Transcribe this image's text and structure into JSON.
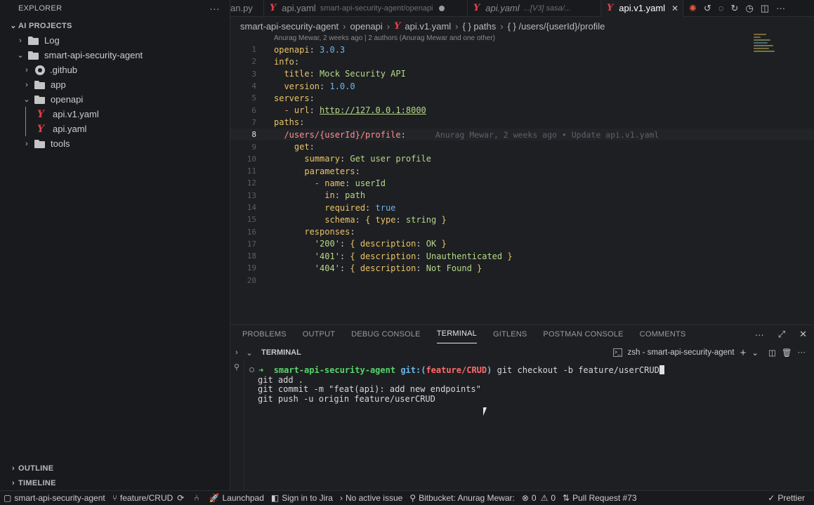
{
  "sidebar": {
    "title": "EXPLORER",
    "section": "AI PROJECTS",
    "items": [
      {
        "label": "Log",
        "type": "folder"
      },
      {
        "label": "smart-api-security-agent",
        "type": "folder-open"
      },
      {
        "label": ".github",
        "type": "github"
      },
      {
        "label": "app",
        "type": "folder"
      },
      {
        "label": "openapi",
        "type": "folder-open"
      },
      {
        "label": "api.v1.yaml",
        "type": "yaml"
      },
      {
        "label": "api.yaml",
        "type": "yaml"
      },
      {
        "label": "tools",
        "type": "folder"
      }
    ],
    "outline": "OUTLINE",
    "timeline": "TIMELINE"
  },
  "tabs": [
    {
      "label": "an.py"
    },
    {
      "label": "api.yaml",
      "desc": "smart-api-security-agent/openapi"
    },
    {
      "label": "api.yaml",
      "desc": "...[V3] sasa/..."
    },
    {
      "label": "api.v1.yaml"
    }
  ],
  "breadcrumb": [
    "smart-api-security-agent",
    "openapi",
    "api.v1.yaml",
    "{ } paths",
    "{ } /users/{userId}/profile"
  ],
  "blame_header": "Anurag Mewar, 2 weeks ago | 2 authors (Anurag Mewar and one other)",
  "editor": {
    "current_line": "8",
    "line_numbers": [
      "1",
      "2",
      "3",
      "4",
      "5",
      "6",
      "7",
      "8",
      "9",
      "10",
      "11",
      "12",
      "13",
      "14",
      "15",
      "16",
      "17",
      "18",
      "19",
      "20"
    ],
    "inline_blame": "Anurag Mewar, 2 weeks ago • Update api.v1.yaml",
    "l1": {
      "k": "openapi",
      "v": "3.0.3"
    },
    "l2": {
      "k": "info"
    },
    "l3": {
      "k": "title",
      "v": "Mock Security API"
    },
    "l4": {
      "k": "version",
      "v": "1.0.0"
    },
    "l5": {
      "k": "servers"
    },
    "l6": {
      "k": "url",
      "v": "http://127.0.0.1:8000"
    },
    "l7": {
      "k": "paths"
    },
    "l8": {
      "k": "/users/{userId}/profile"
    },
    "l9": {
      "k": "get"
    },
    "l10": {
      "k": "summary",
      "v": "Get user profile"
    },
    "l11": {
      "k": "parameters"
    },
    "l12": {
      "k": "name",
      "v": "userId"
    },
    "l13": {
      "k": "in",
      "v": "path"
    },
    "l14": {
      "k": "required",
      "v": "true"
    },
    "l15": {
      "k": "schema",
      "k2": "type",
      "v": "string"
    },
    "l16": {
      "k": "responses"
    },
    "l17": {
      "code": "'200'",
      "k2": "description",
      "v": "OK"
    },
    "l18": {
      "code": "'401'",
      "k2": "description",
      "v": "Unauthenticated"
    },
    "l19": {
      "code": "'404'",
      "k2": "description",
      "v": "Not Found"
    }
  },
  "panel": {
    "tabs": [
      "PROBLEMS",
      "OUTPUT",
      "DEBUG CONSOLE",
      "TERMINAL",
      "GITLENS",
      "POSTMAN CONSOLE",
      "COMMENTS"
    ],
    "active_tab": "TERMINAL",
    "terminal_title": "TERMINAL",
    "shell_label": "zsh - smart-api-security-agent"
  },
  "terminal": {
    "prompt_dir": "smart-api-security-agent",
    "prompt_git": "git:(",
    "prompt_branch": "feature/CRUD",
    "prompt_git_close": ")",
    "command": "git checkout -b feature/userCRUD",
    "lines": [
      "git add .",
      "git commit -m \"feat(api): add new endpoints\"",
      "git push -u origin feature/userCRUD"
    ]
  },
  "statusbar": {
    "remote": "smart-api-security-agent",
    "branch": "feature/CRUD",
    "launchpad": "Launchpad",
    "jira": "Sign in to Jira",
    "issue": "No active issue",
    "bitbucket": "Bitbucket: Anurag Mewar:",
    "errors": "0",
    "warnings": "0",
    "pull_request": "Pull Request #73",
    "prettier": "Prettier"
  },
  "colors": {
    "key": "#e9c46a",
    "string": "#b5d98a",
    "number": "#6cb6e8",
    "yaml_icon": "#e0424a",
    "prompt": "#57d36b"
  }
}
